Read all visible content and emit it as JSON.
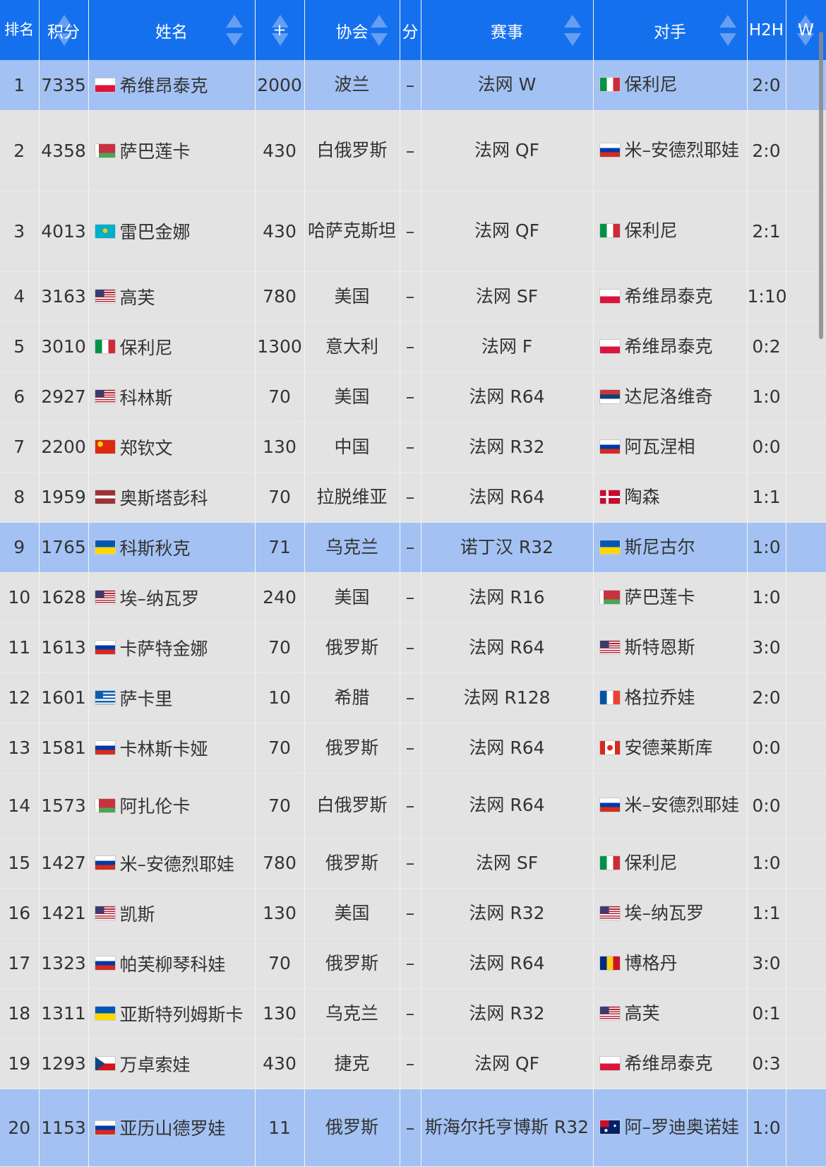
{
  "headers": {
    "rank": "排名",
    "points": "积分",
    "name": "姓名",
    "gain": "+",
    "assoc": "协会",
    "dropped": "分",
    "event": "赛事",
    "opponent": "对手",
    "h2h": "H2H",
    "w": "W"
  },
  "colors": {
    "header_bg": "#1570ee",
    "row_bg": "#e3e3e3",
    "highlight_bg": "#a3c2f3"
  },
  "rows": [
    {
      "rank": "1",
      "points": "7335",
      "flag": "pl",
      "name": "希维昂泰克",
      "gain": "2000",
      "assoc": "波兰",
      "dropped": "–",
      "event": "法网 W",
      "opp_flag": "it",
      "opponent": "保利尼",
      "h2h": "2:0",
      "highlight": true
    },
    {
      "rank": "2",
      "points": "4358",
      "flag": "by",
      "name": "萨巴莲卡",
      "gain": "430",
      "assoc": "白俄罗斯",
      "dropped": "–",
      "event": "法网 QF",
      "opp_flag": "ru",
      "opponent": "米–安德烈耶娃",
      "h2h": "2:0",
      "highlight": false
    },
    {
      "rank": "3",
      "points": "4013",
      "flag": "kz",
      "name": "雷巴金娜",
      "gain": "430",
      "assoc": "哈萨克斯坦",
      "dropped": "–",
      "event": "法网 QF",
      "opp_flag": "it",
      "opponent": "保利尼",
      "h2h": "2:1",
      "highlight": false
    },
    {
      "rank": "4",
      "points": "3163",
      "flag": "us",
      "name": "高芙",
      "gain": "780",
      "assoc": "美国",
      "dropped": "–",
      "event": "法网 SF",
      "opp_flag": "pl",
      "opponent": "希维昂泰克",
      "h2h": "1:10",
      "highlight": false
    },
    {
      "rank": "5",
      "points": "3010",
      "flag": "it",
      "name": "保利尼",
      "gain": "1300",
      "assoc": "意大利",
      "dropped": "–",
      "event": "法网 F",
      "opp_flag": "pl",
      "opponent": "希维昂泰克",
      "h2h": "0:2",
      "highlight": false
    },
    {
      "rank": "6",
      "points": "2927",
      "flag": "us",
      "name": "科林斯",
      "gain": "70",
      "assoc": "美国",
      "dropped": "–",
      "event": "法网 R64",
      "opp_flag": "rs",
      "opponent": "达尼洛维奇",
      "h2h": "1:0",
      "highlight": false
    },
    {
      "rank": "7",
      "points": "2200",
      "flag": "cn",
      "name": "郑钦文",
      "gain": "130",
      "assoc": "中国",
      "dropped": "–",
      "event": "法网 R32",
      "opp_flag": "ru",
      "opponent": "阿瓦涅相",
      "h2h": "0:0",
      "highlight": false
    },
    {
      "rank": "8",
      "points": "1959",
      "flag": "lv",
      "name": "奥斯塔彭科",
      "gain": "70",
      "assoc": "拉脱维亚",
      "dropped": "–",
      "event": "法网 R64",
      "opp_flag": "dk",
      "opponent": "陶森",
      "h2h": "1:1",
      "highlight": false
    },
    {
      "rank": "9",
      "points": "1765",
      "flag": "ua",
      "name": "科斯秋克",
      "gain": "71",
      "assoc": "乌克兰",
      "dropped": "–",
      "event": "诺丁汉 R32",
      "opp_flag": "ua",
      "opponent": "斯尼古尔",
      "h2h": "1:0",
      "highlight": true
    },
    {
      "rank": "10",
      "points": "1628",
      "flag": "us",
      "name": "埃–纳瓦罗",
      "gain": "240",
      "assoc": "美国",
      "dropped": "–",
      "event": "法网 R16",
      "opp_flag": "by",
      "opponent": "萨巴莲卡",
      "h2h": "1:0",
      "highlight": false
    },
    {
      "rank": "11",
      "points": "1613",
      "flag": "ru",
      "name": "卡萨特金娜",
      "gain": "70",
      "assoc": "俄罗斯",
      "dropped": "–",
      "event": "法网 R64",
      "opp_flag": "us",
      "opponent": "斯特恩斯",
      "h2h": "3:0",
      "highlight": false
    },
    {
      "rank": "12",
      "points": "1601",
      "flag": "gr",
      "name": "萨卡里",
      "gain": "10",
      "assoc": "希腊",
      "dropped": "–",
      "event": "法网 R128",
      "opp_flag": "fr",
      "opponent": "格拉乔娃",
      "h2h": "2:0",
      "highlight": false
    },
    {
      "rank": "13",
      "points": "1581",
      "flag": "ru",
      "name": "卡林斯卡娅",
      "gain": "70",
      "assoc": "俄罗斯",
      "dropped": "–",
      "event": "法网 R64",
      "opp_flag": "ca",
      "opponent": "安德莱斯库",
      "h2h": "0:0",
      "highlight": false
    },
    {
      "rank": "14",
      "points": "1573",
      "flag": "by",
      "name": "阿扎伦卡",
      "gain": "70",
      "assoc": "白俄罗斯",
      "dropped": "–",
      "event": "法网 R64",
      "opp_flag": "ru",
      "opponent": "米–安德烈耶娃",
      "h2h": "0:0",
      "highlight": false
    },
    {
      "rank": "15",
      "points": "1427",
      "flag": "ru",
      "name": "米–安德烈耶娃",
      "gain": "780",
      "assoc": "俄罗斯",
      "dropped": "–",
      "event": "法网 SF",
      "opp_flag": "it",
      "opponent": "保利尼",
      "h2h": "1:0",
      "highlight": false
    },
    {
      "rank": "16",
      "points": "1421",
      "flag": "us",
      "name": "凯斯",
      "gain": "130",
      "assoc": "美国",
      "dropped": "–",
      "event": "法网 R32",
      "opp_flag": "us",
      "opponent": "埃–纳瓦罗",
      "h2h": "1:1",
      "highlight": false
    },
    {
      "rank": "17",
      "points": "1323",
      "flag": "ru",
      "name": "帕芙柳琴科娃",
      "gain": "70",
      "assoc": "俄罗斯",
      "dropped": "–",
      "event": "法网 R64",
      "opp_flag": "ro",
      "opponent": "博格丹",
      "h2h": "3:0",
      "highlight": false
    },
    {
      "rank": "18",
      "points": "1311",
      "flag": "ua",
      "name": "亚斯特列姆斯卡",
      "gain": "130",
      "assoc": "乌克兰",
      "dropped": "–",
      "event": "法网 R32",
      "opp_flag": "us",
      "opponent": "高芙",
      "h2h": "0:1",
      "highlight": false
    },
    {
      "rank": "19",
      "points": "1293",
      "flag": "cz",
      "name": "万卓索娃",
      "gain": "430",
      "assoc": "捷克",
      "dropped": "–",
      "event": "法网 QF",
      "opp_flag": "pl",
      "opponent": "希维昂泰克",
      "h2h": "0:3",
      "highlight": false
    },
    {
      "rank": "20",
      "points": "1153",
      "flag": "ru",
      "name": "亚历山德罗娃",
      "gain": "11",
      "assoc": "俄罗斯",
      "dropped": "–",
      "event": "斯海尔托亨博斯 R32",
      "opp_flag": "au",
      "opponent": "阿–罗迪奥诺娃",
      "h2h": "1:0",
      "highlight": true
    }
  ]
}
